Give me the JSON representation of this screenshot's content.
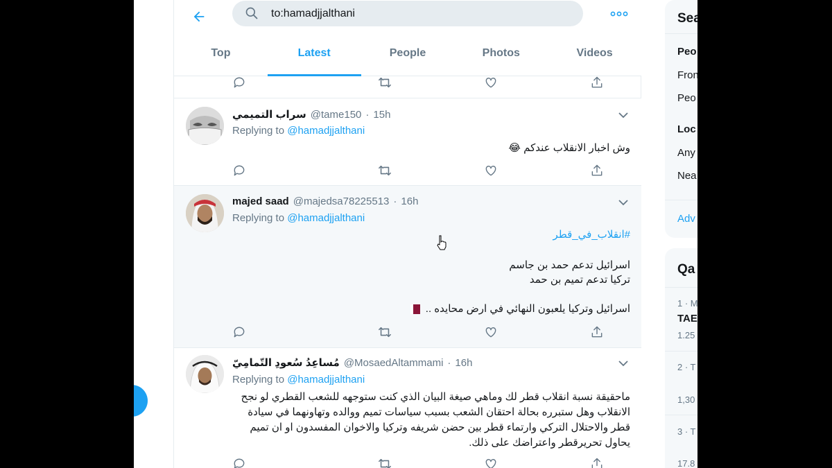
{
  "search": {
    "query": "to:hamadjjalthani"
  },
  "tabs": [
    {
      "label": "Top"
    },
    {
      "label": "Latest"
    },
    {
      "label": "People"
    },
    {
      "label": "Photos"
    },
    {
      "label": "Videos"
    }
  ],
  "active_tab": "Latest",
  "icons": {
    "back": "arrow-left-icon",
    "search": "search-icon",
    "more": "more-horizontal-icon",
    "reply": "reply-icon",
    "retweet": "retweet-icon",
    "like": "heart-icon",
    "share": "share-icon",
    "caret": "chevron-down-icon"
  },
  "colors": {
    "accent": "#1da1f2",
    "muted": "#657786",
    "flag": "#8a1538"
  },
  "tweets": [
    {
      "name": "سراب التميمي",
      "handle": "@tame150",
      "time": "15h",
      "replying_prefix": "Replying to",
      "replying_to": "@hamadjjalthani",
      "text": "وش اخبار الانقلاب عندكم",
      "emoji": "😂"
    },
    {
      "name": "majed saad",
      "handle": "@majedsa78225513",
      "time": "16h",
      "replying_prefix": "Replying to",
      "replying_to": "@hamadjjalthani",
      "hashtag": "#انقلاب_في_قطر",
      "line1": "اسرائيل تدعم حمد بن جاسم",
      "line2": "تركيا تدعم تميم بن حمد",
      "line3": "اسرائيل وتركيا يلعبون النهائي في ارض محايده .."
    },
    {
      "name": "مُساعِدُ سُعودِ التّمامِيّ",
      "handle": "@MosaedAltammami",
      "time": "16h",
      "replying_prefix": "Replying to",
      "replying_to": "@hamadjjalthani",
      "text": "ماحقيقة نسبة انقلاب قطر لك وماهي صيغة البيان الذي كنت ستوجهه للشعب القطري لو نجح الانقلاب وهل ستبرره بحالة احتقان الشعب بسبب سياسات تميم ووالده وتهاونهما في سيادة قطر والاحتلال التركي وارتماء قطر بين حضن شريفه وتركيا والاخوان المفسدون او ان تميم يحاول تحريرقطر واعتراضك على ذلك."
    }
  ],
  "sidebar": {
    "search_title": "Sea",
    "people_label": "Peo",
    "from_label": "Fron",
    "people_option": "Peo",
    "location_label": "Loc",
    "any_label": "Any",
    "near_label": "Nea",
    "advanced": "Adv",
    "trends_title": "Qa",
    "trend1_rank": "1 · M",
    "trend1_name": "TAE",
    "trend1_count": "1.25",
    "trend2_rank": "2 · T",
    "trend2_count": "1,30",
    "trend3_rank": "3 · T",
    "trend3_count": "17.8"
  }
}
